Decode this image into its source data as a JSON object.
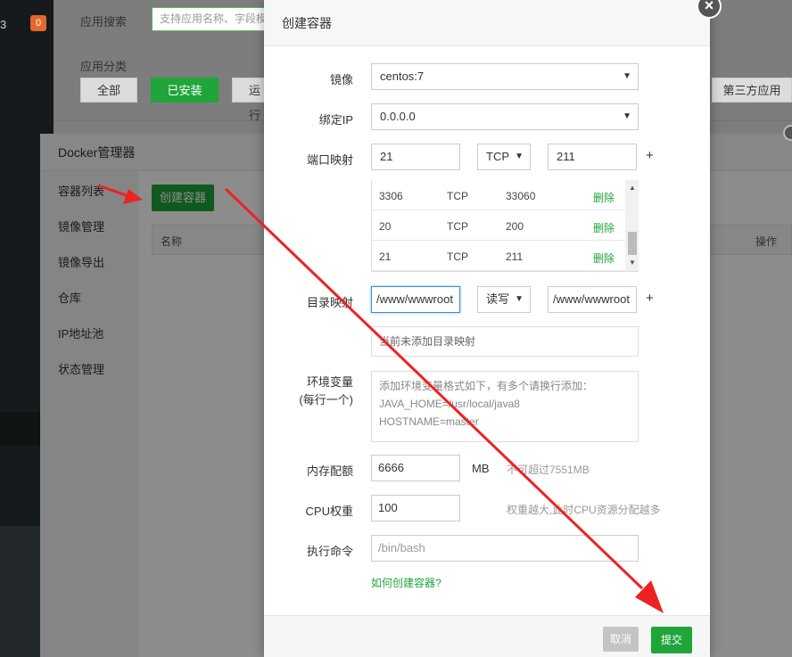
{
  "background": {
    "sidebar_number": "3",
    "sidebar_badge": "0",
    "search_label": "应用搜索",
    "search_placeholder": "支持应用名称、字段模",
    "category_label": "应用分类",
    "tabs": [
      "全部",
      "已安装",
      "运行",
      "第三方应用"
    ]
  },
  "docker": {
    "title": "Docker管理器",
    "side_items": [
      "容器列表",
      "镜像管理",
      "镜像导出",
      "仓库",
      "IP地址池",
      "状态管理"
    ],
    "create_button": "创建容器",
    "col_name": "名称",
    "col_action": "操作"
  },
  "modal": {
    "title": "创建容器",
    "close": "×",
    "image_label": "镜像",
    "image_value": "centos:7",
    "bind_ip_label": "绑定IP",
    "bind_ip_value": "0.0.0.0",
    "port_label": "端口映射",
    "port_inner": "21",
    "port_protocol": "TCP",
    "port_outer": "211",
    "plus": "+",
    "port_rows": [
      {
        "inner": "3306",
        "proto": "TCP",
        "outer": "33060",
        "action": "删除"
      },
      {
        "inner": "20",
        "proto": "TCP",
        "outer": "200",
        "action": "删除"
      },
      {
        "inner": "21",
        "proto": "TCP",
        "outer": "211",
        "action": "删除"
      }
    ],
    "dir_label": "目录映射",
    "dir_host": "/www/wwwroot",
    "dir_mode": "读写",
    "dir_container": "/www/wwwroot",
    "dir_empty": "当前未添加目录映射",
    "env_label": "环境变量",
    "env_label_sub": "(每行一个)",
    "env_placeholder_1": "添加环境变量格式如下，有多个请换行添加：",
    "env_placeholder_2": "JAVA_HOME=/usr/local/java8",
    "env_placeholder_3": "HOSTNAME=master",
    "mem_label": "内存配额",
    "mem_value": "6666",
    "mem_unit": "MB",
    "mem_hint": "不可超过7551MB",
    "cpu_label": "CPU权重",
    "cpu_value": "100",
    "cpu_hint": "权重越大,此时CPU资源分配越多",
    "cmd_label": "执行命令",
    "cmd_placeholder": "/bin/bash",
    "help_link": "如何创建容器?",
    "cancel": "取消",
    "submit": "提交"
  },
  "colors": {
    "accent_green": "#20a53a",
    "arrow_red": "#ee2222"
  }
}
